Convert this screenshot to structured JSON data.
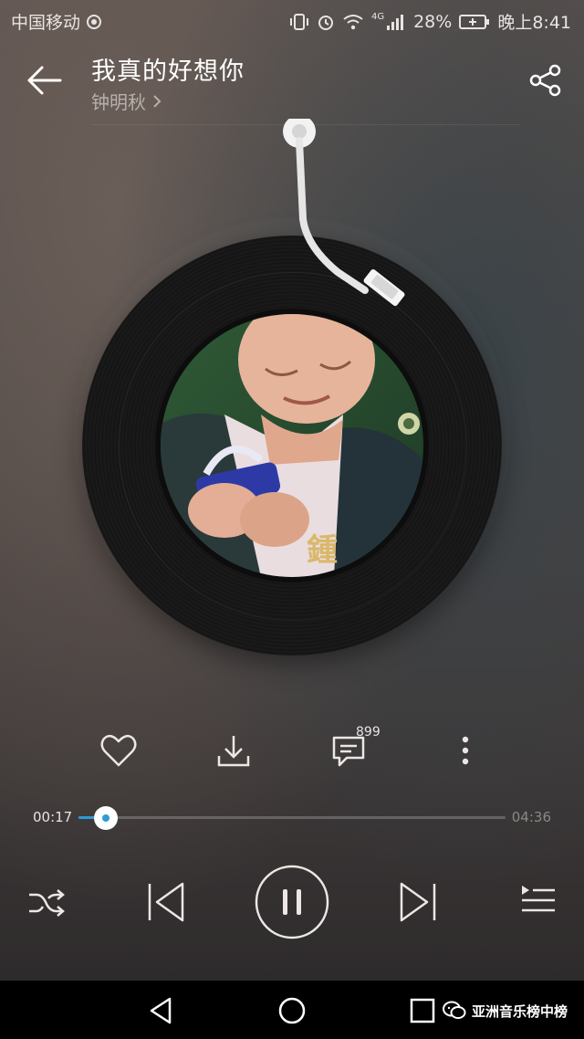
{
  "status_bar": {
    "carrier": "中国移动",
    "network": "4G",
    "battery": "28%",
    "time": "晚上8:41"
  },
  "header": {
    "song_title": "我真的好想你",
    "artist": "钟明秋"
  },
  "actions": {
    "comment_count": "899"
  },
  "progress": {
    "current_time": "00:17",
    "total_time": "04:36",
    "fraction": 0.065
  },
  "watermark": {
    "text": "亚洲音乐榜中榜"
  },
  "icons": {
    "back": "back-arrow-icon",
    "share": "share-icon",
    "favorite": "heart-icon",
    "download": "download-icon",
    "comment": "comment-icon",
    "more": "more-vertical-icon",
    "shuffle": "shuffle-icon",
    "previous": "previous-track-icon",
    "pause": "pause-icon",
    "next": "next-track-icon",
    "playlist": "playlist-icon"
  },
  "colors": {
    "accent": "#2e9bd6",
    "text_primary": "#ffffff",
    "text_secondary": "#b8b0ac"
  }
}
